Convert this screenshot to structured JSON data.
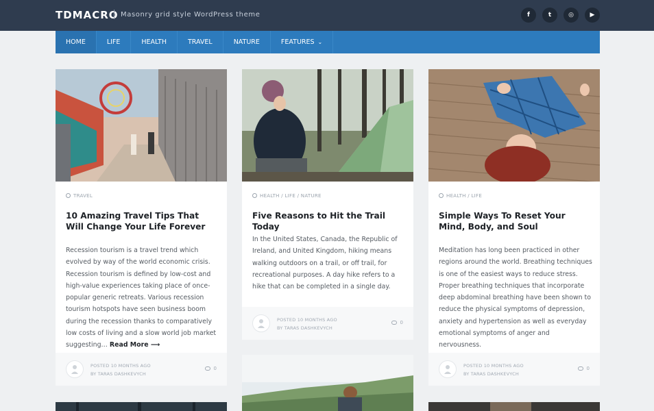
{
  "header": {
    "brand": "TDMACRO",
    "tagline": "Masonry grid style WordPress theme",
    "socials": [
      {
        "icon": "facebook-icon",
        "glyph": "f"
      },
      {
        "icon": "twitter-icon",
        "glyph": "t"
      },
      {
        "icon": "instagram-icon",
        "glyph": "◎"
      },
      {
        "icon": "youtube-icon",
        "glyph": "▶"
      }
    ]
  },
  "nav": {
    "items": [
      "HOME",
      "LIFE",
      "HEALTH",
      "TRAVEL",
      "NATURE",
      "FEATURES"
    ]
  },
  "posts": [
    {
      "category": "TRAVEL",
      "title": "10 Amazing Travel Tips That Will Change Your Life Forever",
      "excerpt": "Recession tourism is a travel trend which evolved by way of the world economic crisis. Recession tourism is defined by low-cost and high-value experiences taking place of once-popular generic retreats. Various recession tourism hotspots have seen business boom during the recession thanks to comparatively low costs of living and a slow world job market suggesting…",
      "read_more": "Read More ⟶",
      "posted": "POSTED 10 MONTHS AGO",
      "author": "BY TARAS DASHKEVYCH",
      "comments": "0"
    },
    {
      "category": "HEALTH / LIFE / NATURE",
      "title": "Five Reasons to Hit the Trail Today",
      "excerpt": "In the United States, Canada, the Republic of Ireland, and United Kingdom, hiking means walking outdoors on a trail, or off trail, for recreational purposes. A day hike refers to a hike that can be completed in a single day.",
      "posted": "POSTED 10 MONTHS AGO",
      "author": "BY TARAS DASHKEVYCH",
      "comments": "0"
    },
    {
      "category": "HEALTH / LIFE",
      "title": "Simple Ways To Reset Your Mind, Body, and Soul",
      "excerpt": "Meditation has long been practiced in other regions around the world. Breathing techniques is one of the easiest ways to reduce stress. Proper breathing techniques that incorporate deep abdominal breathing have been shown to reduce the physical symptoms of depression, anxiety and hypertension as well as everyday emotional symptoms of anger and nervousness.",
      "posted": "POSTED 10 MONTHS AGO",
      "author": "BY TARAS DASHKEVYCH",
      "comments": "0"
    }
  ]
}
